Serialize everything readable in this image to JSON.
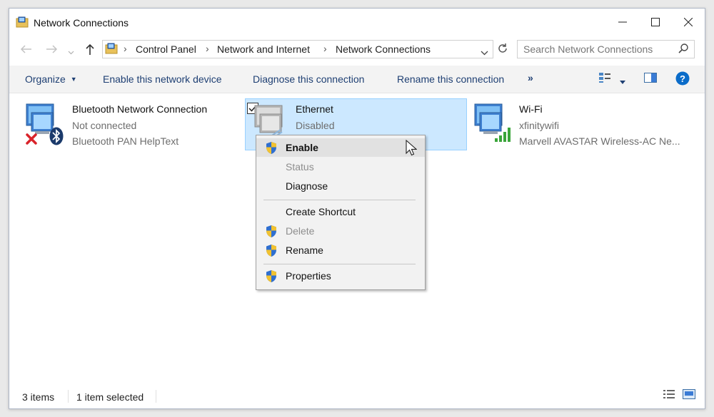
{
  "window": {
    "title": "Network Connections"
  },
  "address": {
    "breadcrumb": [
      "Control Panel",
      "Network and Internet",
      "Network Connections"
    ]
  },
  "search": {
    "placeholder": "Search Network Connections"
  },
  "commands": {
    "organize": "Organize",
    "enable": "Enable this network device",
    "diagnose": "Diagnose this connection",
    "rename": "Rename this connection",
    "more": "»"
  },
  "items": [
    {
      "name": "Bluetooth Network Connection",
      "status": "Not connected",
      "device": "Bluetooth PAN HelpText"
    },
    {
      "name": "Ethernet",
      "status": "Disabled"
    },
    {
      "name": "Wi-Fi",
      "status": "xfinitywifi",
      "device": "Marvell AVASTAR Wireless-AC Ne..."
    }
  ],
  "context_menu": {
    "enable": "Enable",
    "status": "Status",
    "diagnose": "Diagnose",
    "create_shortcut": "Create Shortcut",
    "delete": "Delete",
    "rename": "Rename",
    "properties": "Properties"
  },
  "statusbar": {
    "count": "3 items",
    "selected": "1 item selected"
  },
  "colors": {
    "accent": "#0078d7",
    "selection": "#cce8ff",
    "command_text": "#1e3f73"
  },
  "icons": [
    "network-folder-icon",
    "back-arrow-icon",
    "forward-arrow-icon",
    "up-arrow-icon",
    "refresh-icon",
    "search-icon",
    "help-icon",
    "shield-icon",
    "bluetooth-icon",
    "error-x-icon",
    "wifi-signal-icon",
    "cursor-icon"
  ]
}
